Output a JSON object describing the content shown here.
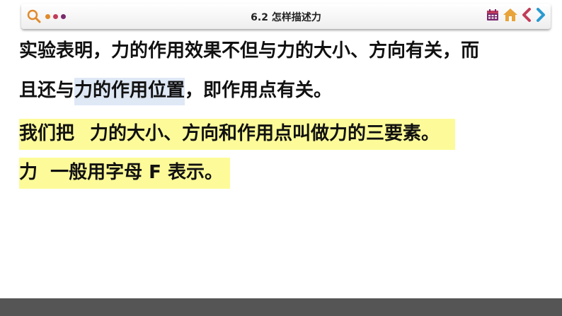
{
  "header": {
    "title": "6.2 怎样描述力",
    "icons": [
      "search-icon",
      "menu-dots-icon",
      "calendar-icon",
      "home-icon",
      "previous-icon",
      "next-icon"
    ]
  },
  "content": {
    "line1": "实验表明，力的作用效果不但与力的大小、方向有关，而",
    "line2_before": "且还与",
    "line2_highlight": "力的作用位置",
    "line2_after": "，即作用点有关。",
    "line3_before": "我们把",
    "line3_highlight": "力的大小、方向和作用点叫做力的三要素。",
    "line4": "力  一般用字母 F 表示。"
  },
  "colors": {
    "highlight_blue": "#dfe8f5",
    "highlight_yellow": "#fdfb99",
    "bottom_bar": "#555555",
    "accent_orange": "#e08a2c",
    "accent_purple": "#7a2a6e"
  }
}
